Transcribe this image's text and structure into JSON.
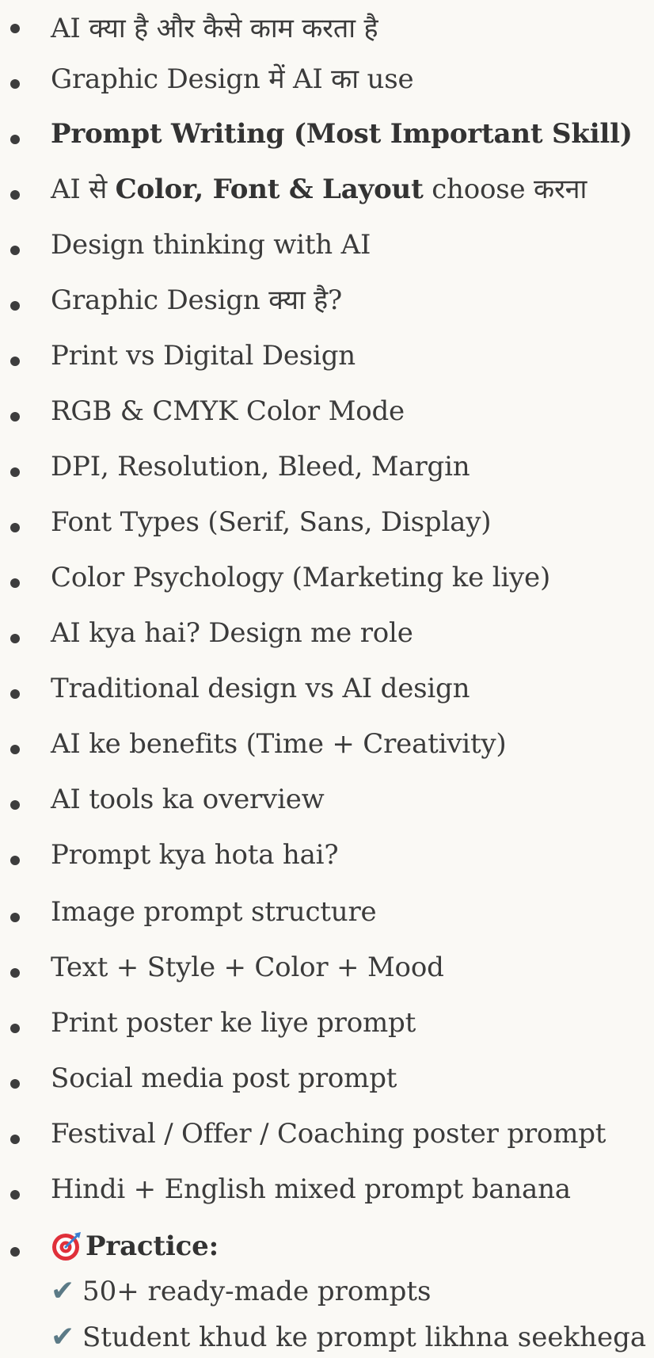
{
  "items": [
    {
      "text": "AI क्या है और कैसे काम करता है"
    },
    {
      "text": "Graphic Design में AI का use"
    },
    {
      "bold": "Prompt Writing (Most Important Skill)"
    },
    {
      "pre": "AI से ",
      "bold": "Color, Font & Layout",
      "post": " choose करना"
    },
    {
      "text": "Design thinking with AI"
    },
    {
      "text": "Graphic Design क्या है?"
    },
    {
      "text": "Print vs Digital Design"
    },
    {
      "text": "RGB & CMYK Color Mode"
    },
    {
      "text": "DPI, Resolution, Bleed, Margin"
    },
    {
      "text": "Font Types (Serif, Sans, Display)"
    },
    {
      "text": "Color Psychology (Marketing ke liye)"
    },
    {
      "text": "AI kya hai? Design me role"
    },
    {
      "text": "Traditional design vs AI design"
    },
    {
      "text": "AI ke benefits (Time + Creativity)"
    },
    {
      "text": "AI tools ka overview"
    },
    {
      "text": "Prompt kya hota hai?"
    },
    {
      "text": "Image prompt structure"
    },
    {
      "text": "Text + Style + Color + Mood"
    },
    {
      "text": "Print poster ke liye prompt"
    },
    {
      "text": "Social media post prompt"
    },
    {
      "text": "Festival / Offer / Coaching poster prompt"
    },
    {
      "text": "Hindi + English mixed prompt banana"
    }
  ],
  "practice": {
    "icon": "target-icon",
    "label": "Practice:",
    "checks": [
      {
        "icon": "check-icon",
        "text": "50+ ready-made prompts"
      },
      {
        "icon": "check-icon",
        "text": "Student khud ke prompt likhna seekhega"
      }
    ]
  },
  "colors": {
    "background": "#faf9f5",
    "text": "#3b3b3b",
    "check": "#5b7a86",
    "target_red": "#e0303a",
    "target_blue": "#3a7fd0"
  }
}
